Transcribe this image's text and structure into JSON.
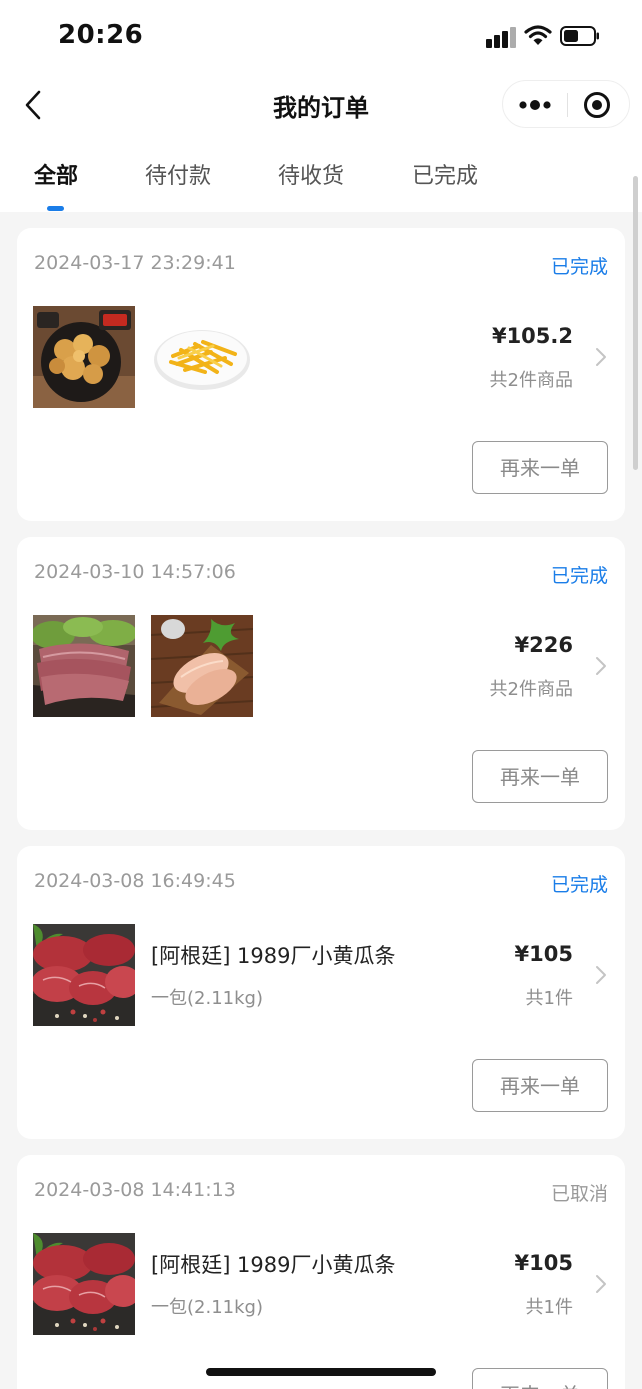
{
  "status_bar": {
    "time": "20:26"
  },
  "nav": {
    "title": "我的订单"
  },
  "tabs": [
    {
      "label": "全部",
      "active": true
    },
    {
      "label": "待付款",
      "active": false
    },
    {
      "label": "待收货",
      "active": false
    },
    {
      "label": "已完成",
      "active": false
    }
  ],
  "orders": [
    {
      "time": "2024-03-17 23:29:41",
      "status": "已完成",
      "images": [
        "fried-chicken-image",
        "french-fries-image"
      ],
      "price": "¥105.2",
      "count": "共2件商品",
      "action": "再来一单"
    },
    {
      "time": "2024-03-10 14:57:06",
      "status": "已完成",
      "images": [
        "raw-pork-image",
        "chicken-breast-image"
      ],
      "price": "¥226",
      "count": "共2件商品",
      "action": "再来一单"
    },
    {
      "time": "2024-03-08 16:49:45",
      "status": "已完成",
      "images": [
        "raw-beef-image"
      ],
      "product_name": "[阿根廷] 1989厂小黄瓜条",
      "product_spec": "一包(2.11kg)",
      "price": "¥105",
      "count": "共1件",
      "action": "再来一单"
    },
    {
      "time": "2024-03-08 14:41:13",
      "status": "已取消",
      "images": [
        "raw-beef-image"
      ],
      "product_name": "[阿根廷] 1989厂小黄瓜条",
      "product_spec": "一包(2.11kg)",
      "price": "¥105",
      "count": "共1件",
      "action": "再来一单"
    }
  ],
  "colors": {
    "accent": "#1a7de8",
    "muted": "#9a9a9a",
    "card": "#ffffff",
    "background": "#f5f5f5"
  }
}
